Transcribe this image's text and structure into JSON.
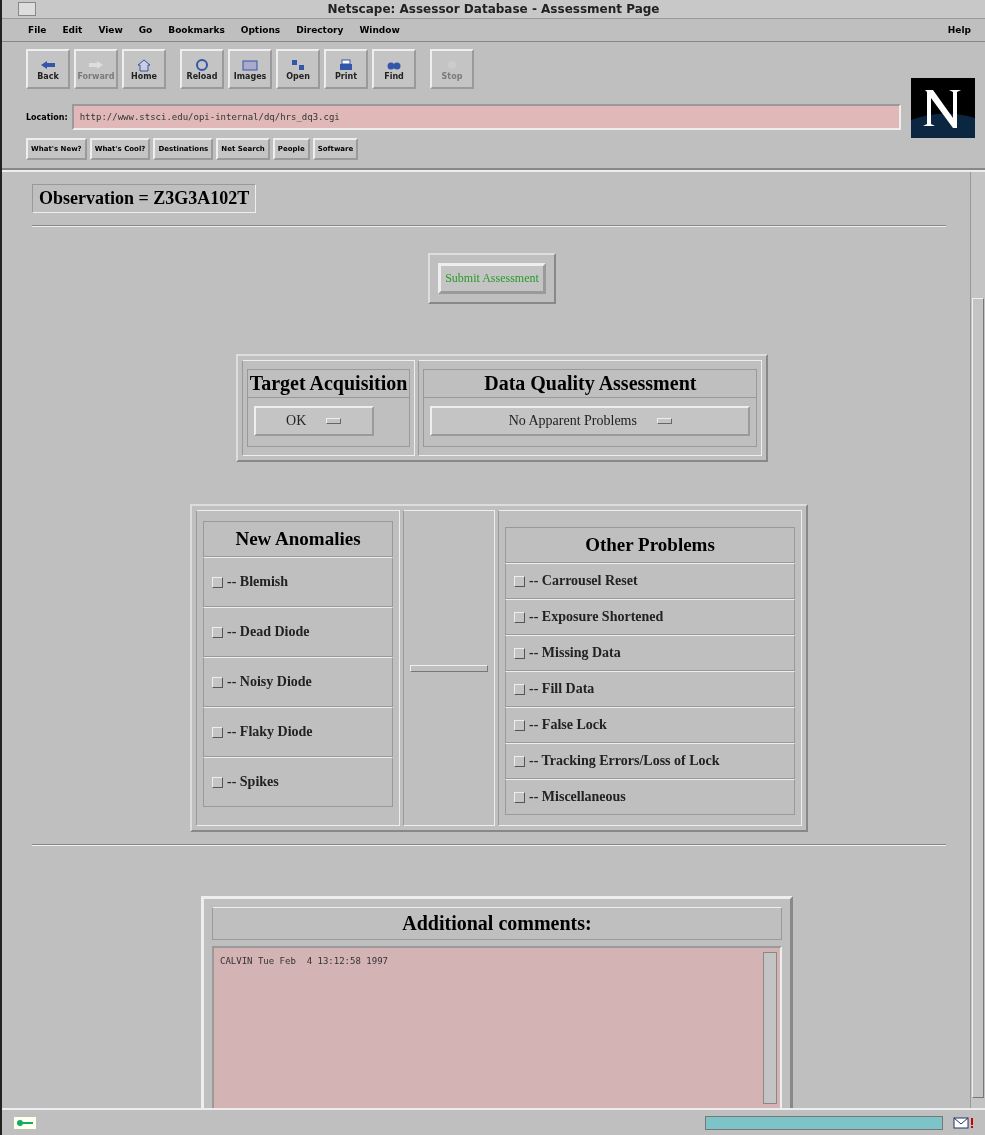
{
  "window": {
    "title": "Netscape: Assessor Database - Assessment Page"
  },
  "menu": {
    "items": [
      "File",
      "Edit",
      "View",
      "Go",
      "Bookmarks",
      "Options",
      "Directory",
      "Window"
    ],
    "help": "Help"
  },
  "toolbar": [
    {
      "label": "Back",
      "disabled": false
    },
    {
      "label": "Forward",
      "disabled": true
    },
    {
      "label": "Home",
      "disabled": false
    },
    {
      "label": "Reload",
      "disabled": false
    },
    {
      "label": "Images",
      "disabled": false
    },
    {
      "label": "Open",
      "disabled": false
    },
    {
      "label": "Print",
      "disabled": false
    },
    {
      "label": "Find",
      "disabled": false
    },
    {
      "label": "Stop",
      "disabled": true
    }
  ],
  "location": {
    "label": "Location:",
    "value": "http://www.stsci.edu/opi-internal/dq/hrs_dq3.cgi"
  },
  "directory_buttons": [
    "What's New?",
    "What's Cool?",
    "Destinations",
    "Net Search",
    "People",
    "Software"
  ],
  "page": {
    "observation": "Observation = Z3G3A102T",
    "submit": "Submit Assessment",
    "target_acquisition": {
      "heading": "Target Acquisition",
      "value": "OK"
    },
    "data_quality": {
      "heading": "Data Quality Assessment",
      "value": "No Apparent Problems"
    },
    "new_anomalies": {
      "heading": "New Anomalies",
      "items": [
        {
          "label": "-- Blemish",
          "checked": false
        },
        {
          "label": "-- Dead Diode",
          "checked": false
        },
        {
          "label": "-- Noisy Diode",
          "checked": false
        },
        {
          "label": "-- Flaky Diode",
          "checked": false
        },
        {
          "label": "-- Spikes",
          "checked": false
        }
      ]
    },
    "other_problems": {
      "heading": "Other Problems",
      "items": [
        {
          "label": "-- Carrousel Reset",
          "checked": false
        },
        {
          "label": "-- Exposure Shortened",
          "checked": false
        },
        {
          "label": "-- Missing Data",
          "checked": false
        },
        {
          "label": "-- Fill Data",
          "checked": false
        },
        {
          "label": "-- False Lock",
          "checked": false
        },
        {
          "label": "-- Tracking Errors/Loss of Lock",
          "checked": false
        },
        {
          "label": "-- Miscellaneous",
          "checked": false
        }
      ]
    },
    "comments": {
      "heading": "Additional comments:",
      "value": "CALVIN Tue Feb  4 13:12:58 1997"
    }
  },
  "status_bar": {
    "progress": {
      "level": 1
    }
  }
}
